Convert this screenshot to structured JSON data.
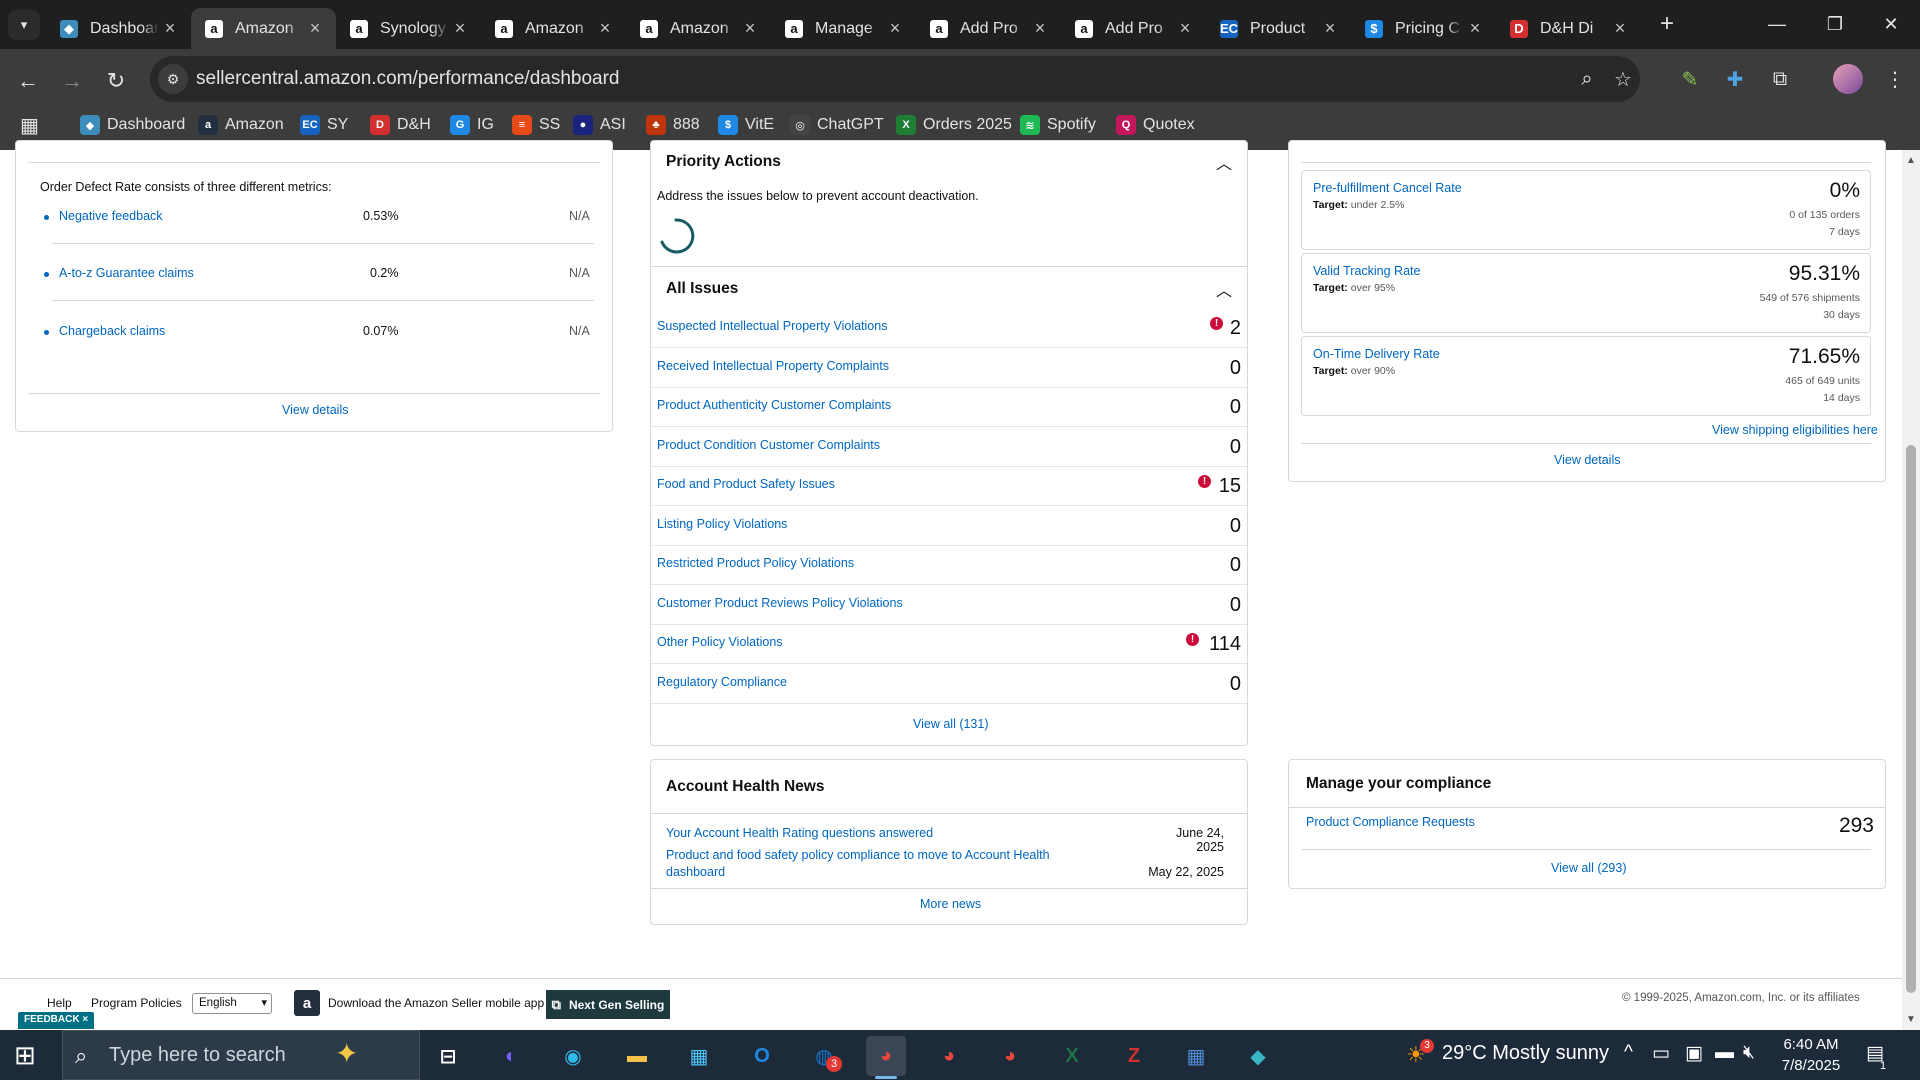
{
  "browser": {
    "tabs": [
      {
        "title": "Dashboard",
        "icon": "tab-favicon-dashboard",
        "active": false
      },
      {
        "title": "Amazon",
        "icon": "amazon-icon",
        "active": true
      },
      {
        "title": "Synology",
        "icon": "amazon-icon",
        "active": false
      },
      {
        "title": "Amazon",
        "icon": "amazon-icon",
        "active": false
      },
      {
        "title": "Amazon",
        "icon": "amazon-icon",
        "active": false
      },
      {
        "title": "Manage",
        "icon": "amazon-icon",
        "active": false
      },
      {
        "title": "Add Pro",
        "icon": "amazon-icon",
        "active": false
      },
      {
        "title": "Add Pro",
        "icon": "amazon-icon",
        "active": false
      },
      {
        "title": "Product",
        "icon": "ec-icon",
        "active": false
      },
      {
        "title": "Pricing C",
        "icon": "pricing-icon",
        "active": false
      },
      {
        "title": "D&H Di",
        "icon": "dh-icon",
        "active": false
      }
    ],
    "url": "sellercentral.amazon.com/performance/dashboard",
    "bookmarks": [
      {
        "label": "Dashboard",
        "color": "#3c8dbc",
        "glyph": "◆"
      },
      {
        "label": "Amazon",
        "color": "#232f3e",
        "glyph": "a"
      },
      {
        "label": "SY",
        "color": "#1565c0",
        "glyph": "EC"
      },
      {
        "label": "D&H",
        "color": "#d32f2f",
        "glyph": "D"
      },
      {
        "label": "IG",
        "color": "#1e88e5",
        "glyph": "G"
      },
      {
        "label": "SS",
        "color": "#e64a19",
        "glyph": "≡"
      },
      {
        "label": "ASI",
        "color": "#1a237e",
        "glyph": "●"
      },
      {
        "label": "888",
        "color": "#bf360c",
        "glyph": "♣"
      },
      {
        "label": "VitE",
        "color": "#1e88e5",
        "glyph": "$"
      },
      {
        "label": "ChatGPT",
        "color": "#444444",
        "glyph": "◎"
      },
      {
        "label": "Orders 2025",
        "color": "#1e7e34",
        "glyph": "X"
      },
      {
        "label": "Spotify",
        "color": "#1db954",
        "glyph": "≋"
      },
      {
        "label": "Quotex",
        "color": "#c2185b",
        "glyph": "Q"
      }
    ]
  },
  "odr_card": {
    "intro": "Order Defect Rate consists of three different metrics:",
    "metrics": [
      {
        "label": "Negative feedback",
        "value": "0.53%",
        "status": "N/A"
      },
      {
        "label": "A-to-z Guarantee claims",
        "value": "0.2%",
        "status": "N/A"
      },
      {
        "label": "Chargeback claims",
        "value": "0.07%",
        "status": "N/A"
      }
    ],
    "view_details": "View details"
  },
  "priority_actions": {
    "title": "Priority Actions",
    "subtitle": "Address the issues below to prevent account deactivation."
  },
  "all_issues": {
    "title": "All Issues",
    "rows": [
      {
        "label": "Suspected Intellectual Property Violations",
        "count": "2",
        "alert": true
      },
      {
        "label": "Received Intellectual Property Complaints",
        "count": "0",
        "alert": false
      },
      {
        "label": "Product Authenticity Customer Complaints",
        "count": "0",
        "alert": false
      },
      {
        "label": "Product Condition Customer Complaints",
        "count": "0",
        "alert": false
      },
      {
        "label": "Food and Product Safety Issues",
        "count": "15",
        "alert": true
      },
      {
        "label": "Listing Policy Violations",
        "count": "0",
        "alert": false
      },
      {
        "label": "Restricted Product Policy Violations",
        "count": "0",
        "alert": false
      },
      {
        "label": "Customer Product Reviews Policy Violations",
        "count": "0",
        "alert": false
      },
      {
        "label": "Other Policy Violations",
        "count": "114",
        "alert": true
      },
      {
        "label": "Regulatory Compliance",
        "count": "0",
        "alert": false
      }
    ],
    "view_all": "View all (131)"
  },
  "news": {
    "title": "Account Health News",
    "items": [
      {
        "text": "Your Account Health Rating questions answered",
        "date": "June 24, 2025"
      },
      {
        "text": "Product and food safety policy compliance to move to Account Health dashboard",
        "date": "May 22, 2025"
      }
    ],
    "more": "More news"
  },
  "shipping": {
    "metrics": [
      {
        "title": "Pre-fulfillment Cancel Rate",
        "target_label": "Target:",
        "target": "under 2.5%",
        "value": "0%",
        "detail1": "0 of 135 orders",
        "detail2": "7 days"
      },
      {
        "title": "Valid Tracking Rate",
        "target_label": "Target:",
        "target": "over 95%",
        "value": "95.31%",
        "detail1": "549 of 576 shipments",
        "detail2": "30 days"
      },
      {
        "title": "On-Time Delivery Rate",
        "target_label": "Target:",
        "target": "over 90%",
        "value": "71.65%",
        "detail1": "465 of 649 units",
        "detail2": "14 days"
      }
    ],
    "eligibility_link": "View shipping eligibilities here",
    "view_details": "View details"
  },
  "compliance": {
    "title": "Manage your compliance",
    "row_label": "Product Compliance Requests",
    "row_count": "293",
    "view_all": "View all (293)"
  },
  "footer": {
    "help": "Help",
    "program_policies": "Program Policies",
    "language": "English",
    "app_download": "Download the Amazon Seller mobile app",
    "next_gen": "Next Gen Selling",
    "copyright": "© 1999-2025, Amazon.com, Inc. or its affiliates",
    "feedback": "FEEDBACK"
  },
  "taskbar": {
    "search_placeholder": "Type here to search",
    "weather": "29°C  Mostly sunny",
    "weather_badge": "3",
    "time": "6:40 AM",
    "date": "7/8/2025",
    "notification_count": "1",
    "outlook_badge": "3"
  },
  "colors": {
    "link": "#0066c0",
    "alert": "#cc0c39",
    "accent": "#1f3a3d"
  }
}
